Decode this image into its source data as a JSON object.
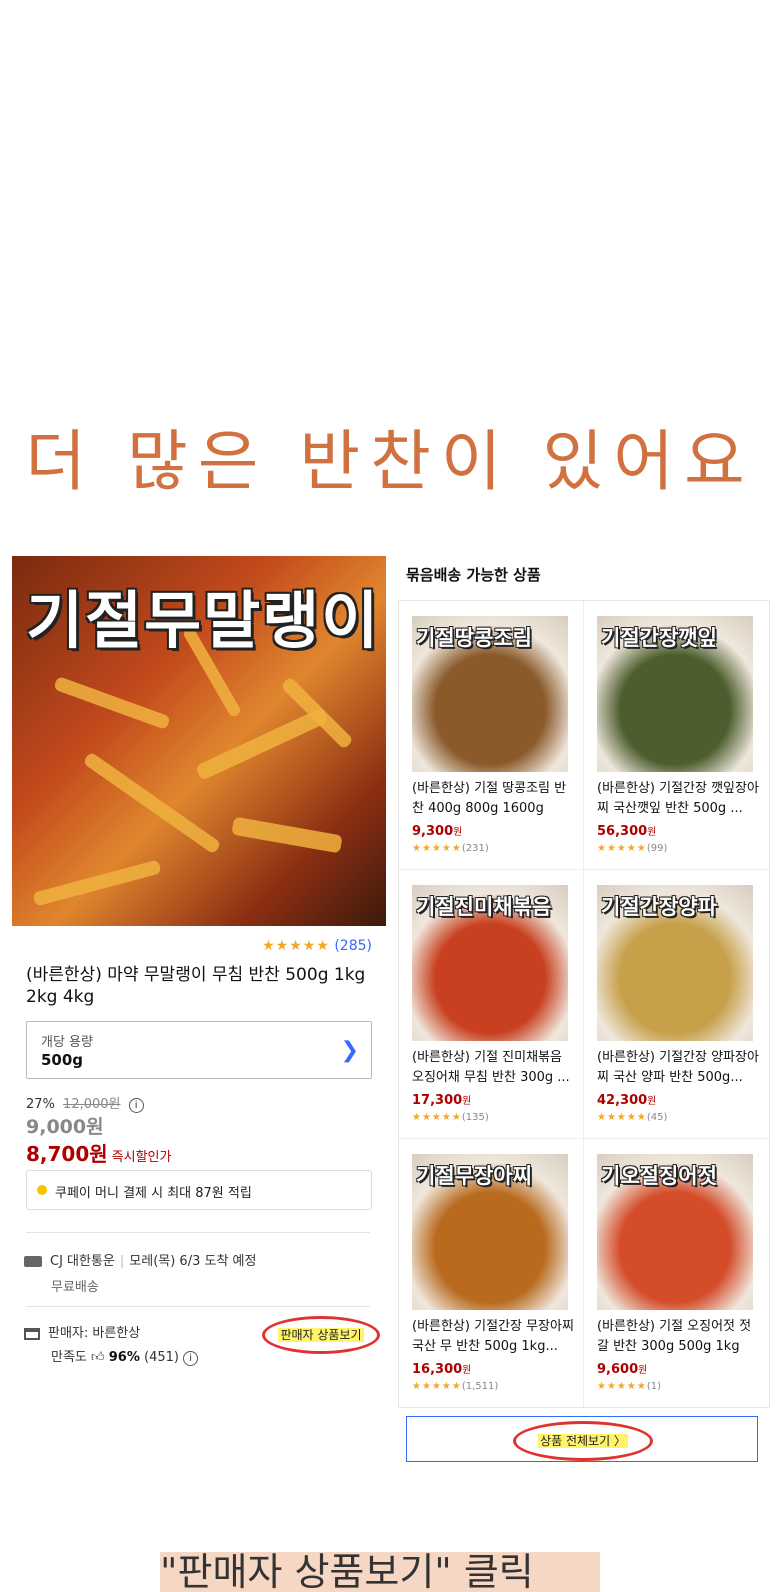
{
  "headline": "더 많은 반찬이 있어요",
  "product": {
    "image_text": "기절무말랭이",
    "rating_stars": "★★★★★",
    "rating_count": "(285)",
    "title": "(바른한상) 마약 무말랭이 무침 반찬 500g 1kg 2kg 4kg",
    "option_label": "개당 용량",
    "option_value": "500g",
    "discount_rate": "27%",
    "original_price": "12,000원",
    "sale_price": "9,000원",
    "instant_price": "8,700원",
    "instant_label": "즉시할인가",
    "coupay_text": "쿠페이 머니 결제 시 최대 87원 적립",
    "shipping_carrier": "CJ 대한통운",
    "shipping_eta": "모레(목) 6/3 도착 예정",
    "shipping_fee": "무료배송",
    "seller_label": "판매자: 바른한상",
    "satisfaction_label": "만족도",
    "satisfaction_value": "96%",
    "satisfaction_count": "(451)",
    "seller_button": "판매자 상품보기"
  },
  "bundle": {
    "title": "묶음배송 가능한 상품",
    "items": [
      {
        "image_text": "기절땅콩조림",
        "name": "(바른한상) 기절 땅콩조림 반찬 400g 800g 1600g",
        "price": "9,300",
        "unit": "원",
        "stars": "★★★★★",
        "count": "(231)",
        "color": "#8a5a2b"
      },
      {
        "image_text": "기절간장깻잎",
        "name": "(바른한상) 기절간장 깻잎장아찌 국산깻잎 반찬 500g ...",
        "price": "56,300",
        "unit": "원",
        "stars": "★★★★★",
        "count": "(99)",
        "color": "#4d5e2e"
      },
      {
        "image_text": "기절진미채볶음",
        "name": "(바른한상) 기절 진미채볶음 오징어채 무침 반찬 300g ...",
        "price": "17,300",
        "unit": "원",
        "stars": "★★★★★",
        "count": "(135)",
        "color": "#c8401f"
      },
      {
        "image_text": "기절간장양파",
        "name": "(바른한상) 기절간장 양파장아찌 국산 양파 반찬 500g...",
        "price": "42,300",
        "unit": "원",
        "stars": "★★★★★",
        "count": "(45)",
        "color": "#c7a04a"
      },
      {
        "image_text": "기절무장아찌",
        "name": "(바른한상) 기절간장 무장아찌 국산 무 반찬 500g 1kg...",
        "price": "16,300",
        "unit": "원",
        "stars": "★★★★★",
        "count": "(1,511)",
        "color": "#b86a1e"
      },
      {
        "image_text": "기오절징어젓",
        "name": "(바른한상) 기절 오징어젓 젓갈 반찬 300g 500g 1kg",
        "price": "9,600",
        "unit": "원",
        "stars": "★★★★★",
        "count": "(1)",
        "color": "#d44c2a"
      }
    ],
    "view_all": "상품 전체보기 〉"
  },
  "footer_text": "\"판매자 상품보기\" 클릭"
}
